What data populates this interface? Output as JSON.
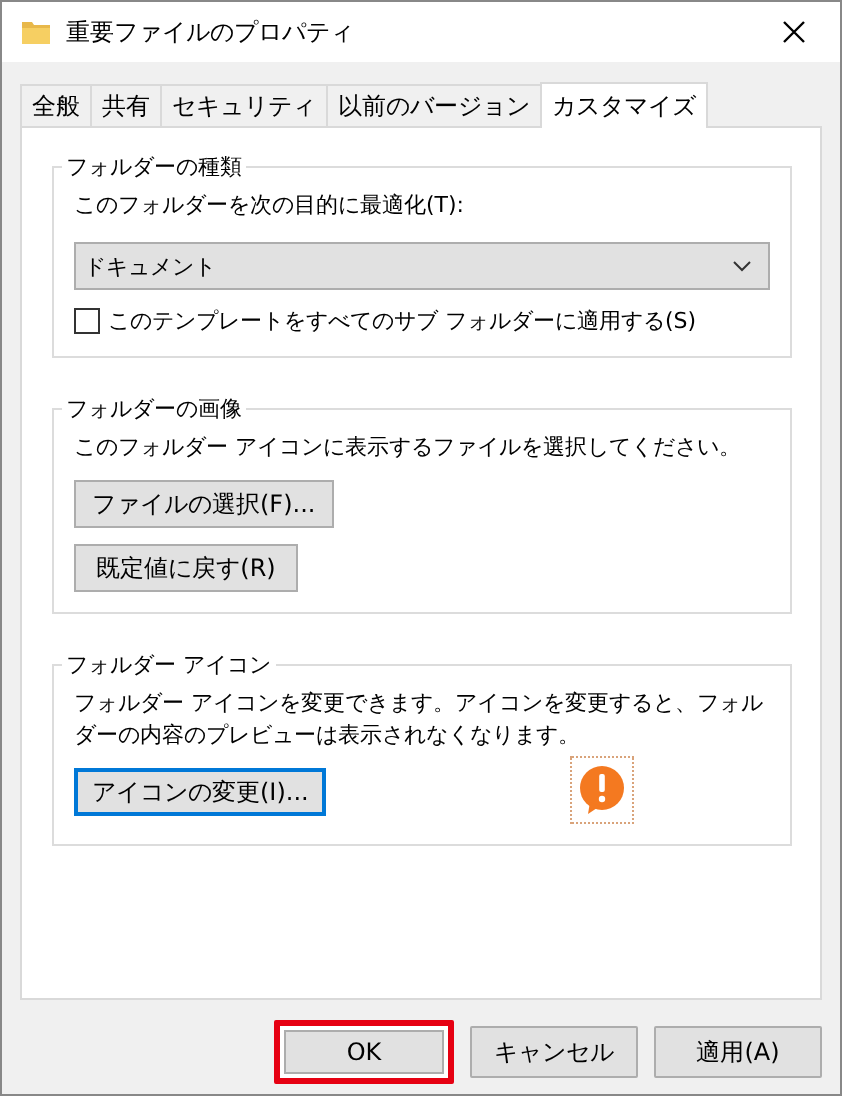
{
  "window": {
    "title": "重要ファイルのプロパティ"
  },
  "tabs": [
    {
      "label": "全般",
      "selected": false
    },
    {
      "label": "共有",
      "selected": false
    },
    {
      "label": "セキュリティ",
      "selected": false
    },
    {
      "label": "以前のバージョン",
      "selected": false
    },
    {
      "label": "カスタマイズ",
      "selected": true
    }
  ],
  "folder_type": {
    "heading": "フォルダーの種類",
    "label": "このフォルダーを次の目的に最適化(T):",
    "dropdown": {
      "value": "ドキュメント"
    },
    "checkbox": {
      "label": "このテンプレートをすべてのサブ フォルダーに適用する(S)",
      "checked": false
    }
  },
  "folder_picture": {
    "heading": "フォルダーの画像",
    "description": "このフォルダー アイコンに表示するファイルを選択してください。",
    "buttons": [
      "ファイルの選択(F)...",
      "既定値に戻す(R)"
    ]
  },
  "folder_icon": {
    "heading": "フォルダー アイコン",
    "description": "フォルダー アイコンを変更できます。アイコンを変更すると、フォルダーの内容のプレビューは表示されなくなります。",
    "button": {
      "label": "アイコンの変更(I)...",
      "focused": true
    }
  },
  "buttons": [
    {
      "label": "OK",
      "highlighted": true
    },
    {
      "label": "キャンセル",
      "highlighted": false
    },
    {
      "label": "適用(A)",
      "highlighted": false
    }
  ]
}
